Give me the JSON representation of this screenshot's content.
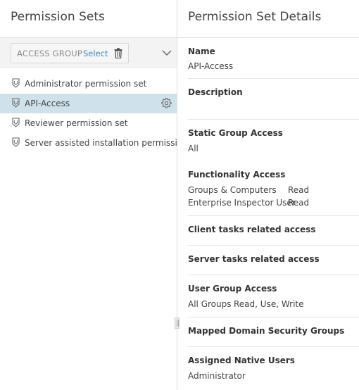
{
  "left_panel": {
    "title": "Permission Sets",
    "filter": {
      "label": "ACCESS GROUP",
      "select_link": "Select"
    },
    "items": [
      {
        "label": "Administrator permission set",
        "selected": false
      },
      {
        "label": "API-Access",
        "selected": true
      },
      {
        "label": "Reviewer permission set",
        "selected": false
      },
      {
        "label": "Server assisted installation permission set",
        "selected": false
      }
    ]
  },
  "details": {
    "title": "Permission Set Details",
    "name": {
      "label": "Name",
      "value": "API-Access"
    },
    "description": {
      "label": "Description",
      "value": ""
    },
    "static_group_access": {
      "label": "Static Group Access",
      "value": "All"
    },
    "functionality_access": {
      "label": "Functionality Access",
      "rows": [
        {
          "key": "Groups & Computers",
          "value": "Read"
        },
        {
          "key": "Enterprise Inspector User",
          "value": "Read"
        }
      ]
    },
    "client_tasks": {
      "label": "Client tasks related access"
    },
    "server_tasks": {
      "label": "Server tasks related access"
    },
    "user_group_access": {
      "label": "User Group Access",
      "key": "All Groups",
      "value": "Read, Use, Write"
    },
    "mapped_domain_groups": {
      "label": "Mapped Domain Security Groups"
    },
    "assigned_native_users": {
      "label": "Assigned Native Users",
      "value": "Administrator"
    }
  },
  "colors": {
    "link": "#3a86c8",
    "selected_row": "#cfe2ec",
    "toolbar_bg": "#f3f3f3"
  },
  "icons": {
    "trash": "trash-icon",
    "chevron": "chevron-down-icon",
    "permission_set": "shield-icon",
    "settings": "gear-icon"
  }
}
